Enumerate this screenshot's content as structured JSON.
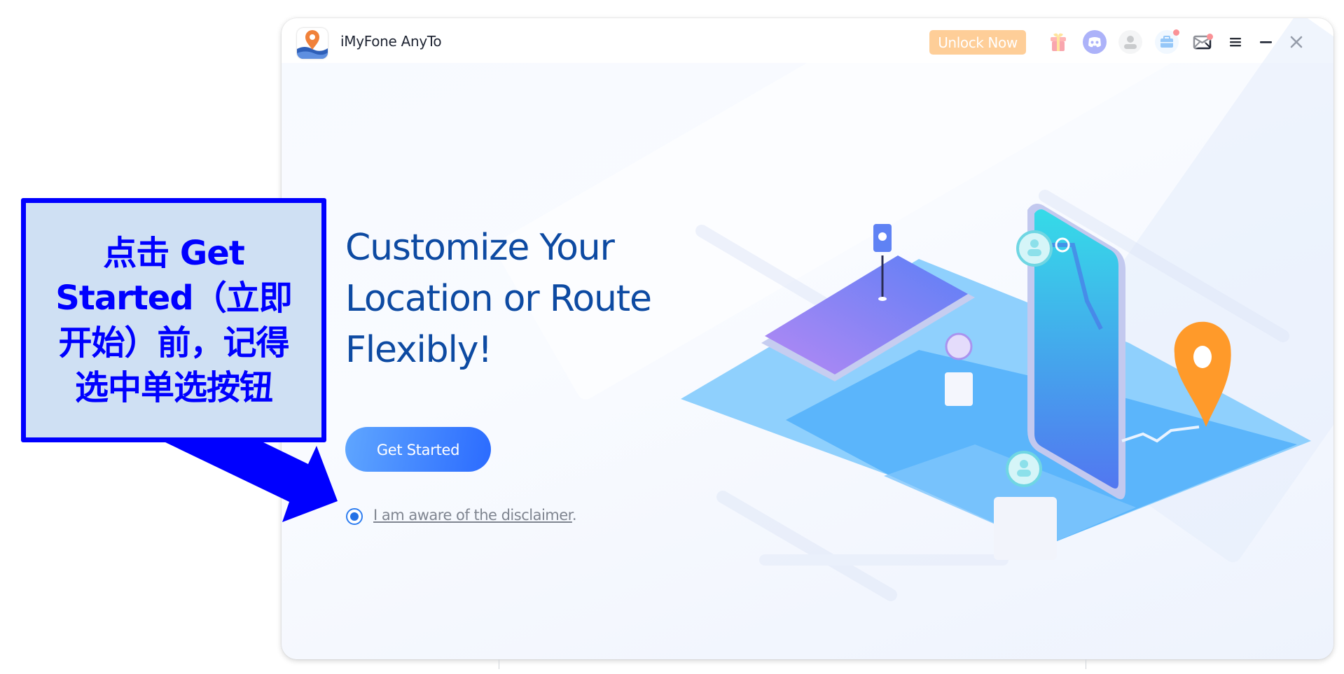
{
  "window": {
    "app_title": "iMyFone AnyTo",
    "unlock_button": "Unlock Now",
    "icons": [
      "gift-icon",
      "discord-icon",
      "user-avatar-icon",
      "toolbox-icon",
      "mail-icon",
      "menu-icon",
      "minimize-icon",
      "close-icon"
    ],
    "colors": {
      "unlock": "#fd9c31",
      "accent": "#2b6bff",
      "headline": "#0d4aa2",
      "badge": "#f5222d"
    }
  },
  "main": {
    "headline_lines": [
      "Customize Your",
      "Location or Route",
      "Flexibly!"
    ],
    "get_started_label": "Get Started",
    "disclaimer_radio_checked": true,
    "disclaimer_link_text": "I am aware of the disclaimer",
    "disclaimer_suffix": "."
  },
  "annotation": {
    "callout_lines": [
      "点击 Get",
      "Started（立即",
      "开始）前，记得",
      "选中单选按钮"
    ],
    "colors": {
      "border": "#0000ff",
      "fill": "#cfe0f3",
      "text": "#0000ff"
    }
  }
}
